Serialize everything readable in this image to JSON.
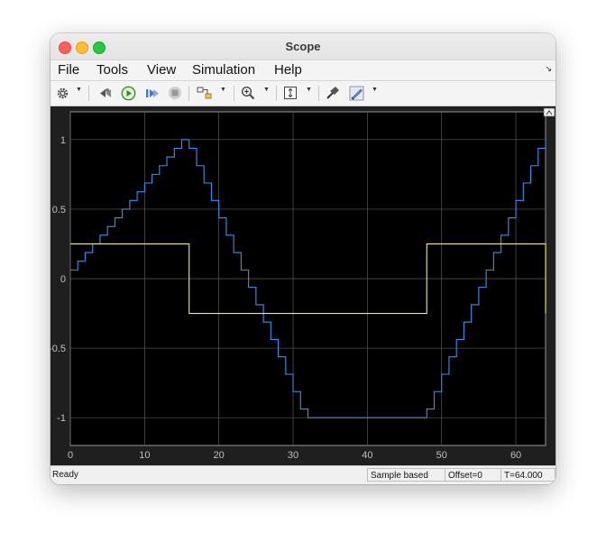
{
  "window": {
    "title": "Scope"
  },
  "menu": {
    "items": [
      "File",
      "Tools",
      "View",
      "Simulation",
      "Help"
    ]
  },
  "toolbar": {
    "buttons": [
      "configuration-properties",
      "step-back",
      "run",
      "step-forward",
      "stop",
      "highlight-block",
      "zoom-in",
      "scale-y-axis",
      "signal-selector",
      "style"
    ]
  },
  "status": {
    "ready": "Ready",
    "mode": "Sample based",
    "offset": "Offset=0",
    "time": "T=64.000"
  },
  "colors": {
    "plot_bg": "#000000",
    "axes_bg": "#1f1f1f",
    "grid": "#5a5a5a",
    "series_1": "#3d8ff0",
    "series_2": "#f2f26a",
    "tick_text": "#bfbfbf"
  },
  "chart_data": {
    "type": "line",
    "step": true,
    "xlim": [
      0,
      64
    ],
    "ylim": [
      -1.2,
      1.2
    ],
    "xticks": [
      0,
      10,
      20,
      30,
      40,
      50,
      60
    ],
    "yticks": [
      1,
      0.5,
      0,
      -0.5,
      -1
    ],
    "ytick_labels": [
      "1",
      "0.5",
      "0",
      "-0.5",
      "-1"
    ],
    "grid": true,
    "series": [
      {
        "x": [
          0,
          1,
          2,
          3,
          4,
          5,
          6,
          7,
          8,
          9,
          10,
          11,
          12,
          13,
          14,
          15,
          16,
          17,
          18,
          19,
          20,
          21,
          22,
          23,
          24,
          25,
          26,
          27,
          28,
          29,
          30,
          31,
          32,
          33,
          34,
          35,
          36,
          37,
          38,
          39,
          40,
          41,
          42,
          43,
          44,
          45,
          46,
          47,
          48,
          49,
          50,
          51,
          52,
          53,
          54,
          55,
          56,
          57,
          58,
          59,
          60,
          61,
          62,
          63,
          64
        ],
        "y": [
          0.0625,
          0.125,
          0.1875,
          0.25,
          0.3125,
          0.375,
          0.4375,
          0.5,
          0.5625,
          0.625,
          0.6875,
          0.75,
          0.8125,
          0.875,
          0.9375,
          1.0,
          0.9375,
          0.8125,
          0.6875,
          0.5625,
          0.4375,
          0.3125,
          0.1875,
          0.0625,
          -0.0625,
          -0.1875,
          -0.3125,
          -0.4375,
          -0.5625,
          -0.6875,
          -0.8125,
          -0.9375,
          -1.0,
          -1.0,
          -1.0,
          -1.0,
          -1.0,
          -1.0,
          -1.0,
          -1.0,
          -1.0,
          -1.0,
          -1.0,
          -1.0,
          -1.0,
          -1.0,
          -1.0,
          -1.0,
          -0.9375,
          -0.8125,
          -0.6875,
          -0.5625,
          -0.4375,
          -0.3125,
          -0.1875,
          -0.0625,
          0.0625,
          0.1875,
          0.3125,
          0.4375,
          0.5625,
          0.6875,
          0.8125,
          0.9375,
          1.0
        ]
      },
      {
        "x": [
          0,
          16,
          16,
          48,
          48,
          64,
          64
        ],
        "y": [
          0.25,
          0.25,
          -0.25,
          -0.25,
          0.25,
          0.25,
          -0.25
        ]
      }
    ]
  }
}
